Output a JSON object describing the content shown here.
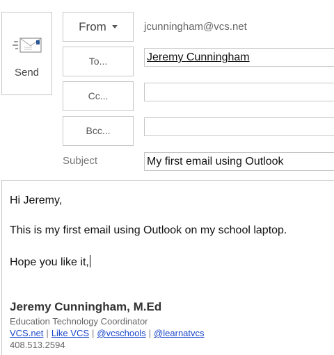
{
  "send": {
    "label": "Send",
    "icon": "send-envelope-icon"
  },
  "header": {
    "from_label": "From",
    "from_address": "jcunningham@vcs.net",
    "to_label": "To...",
    "cc_label": "Cc...",
    "bcc_label": "Bcc...",
    "subject_label": "Subject"
  },
  "fields": {
    "to_value": "Jeremy Cunningham",
    "cc_value": "",
    "bcc_value": "",
    "subject_value": "My first email using Outlook"
  },
  "body": {
    "lines": [
      "Hi Jeremy,",
      "This is my first email using Outlook on my school laptop.",
      "Hope you like it,"
    ]
  },
  "signature": {
    "name": "Jeremy Cunningham, M.Ed",
    "title": "Education Technology Coordinator",
    "links": [
      "VCS.net",
      "Like VCS",
      "@vcschools",
      "@learnatvcs"
    ],
    "separator": "|",
    "phone": "408.513.2594"
  },
  "colors": {
    "border": "#c6c6c6",
    "link": "#1a47c8",
    "envelope_blue": "#2b5797"
  }
}
